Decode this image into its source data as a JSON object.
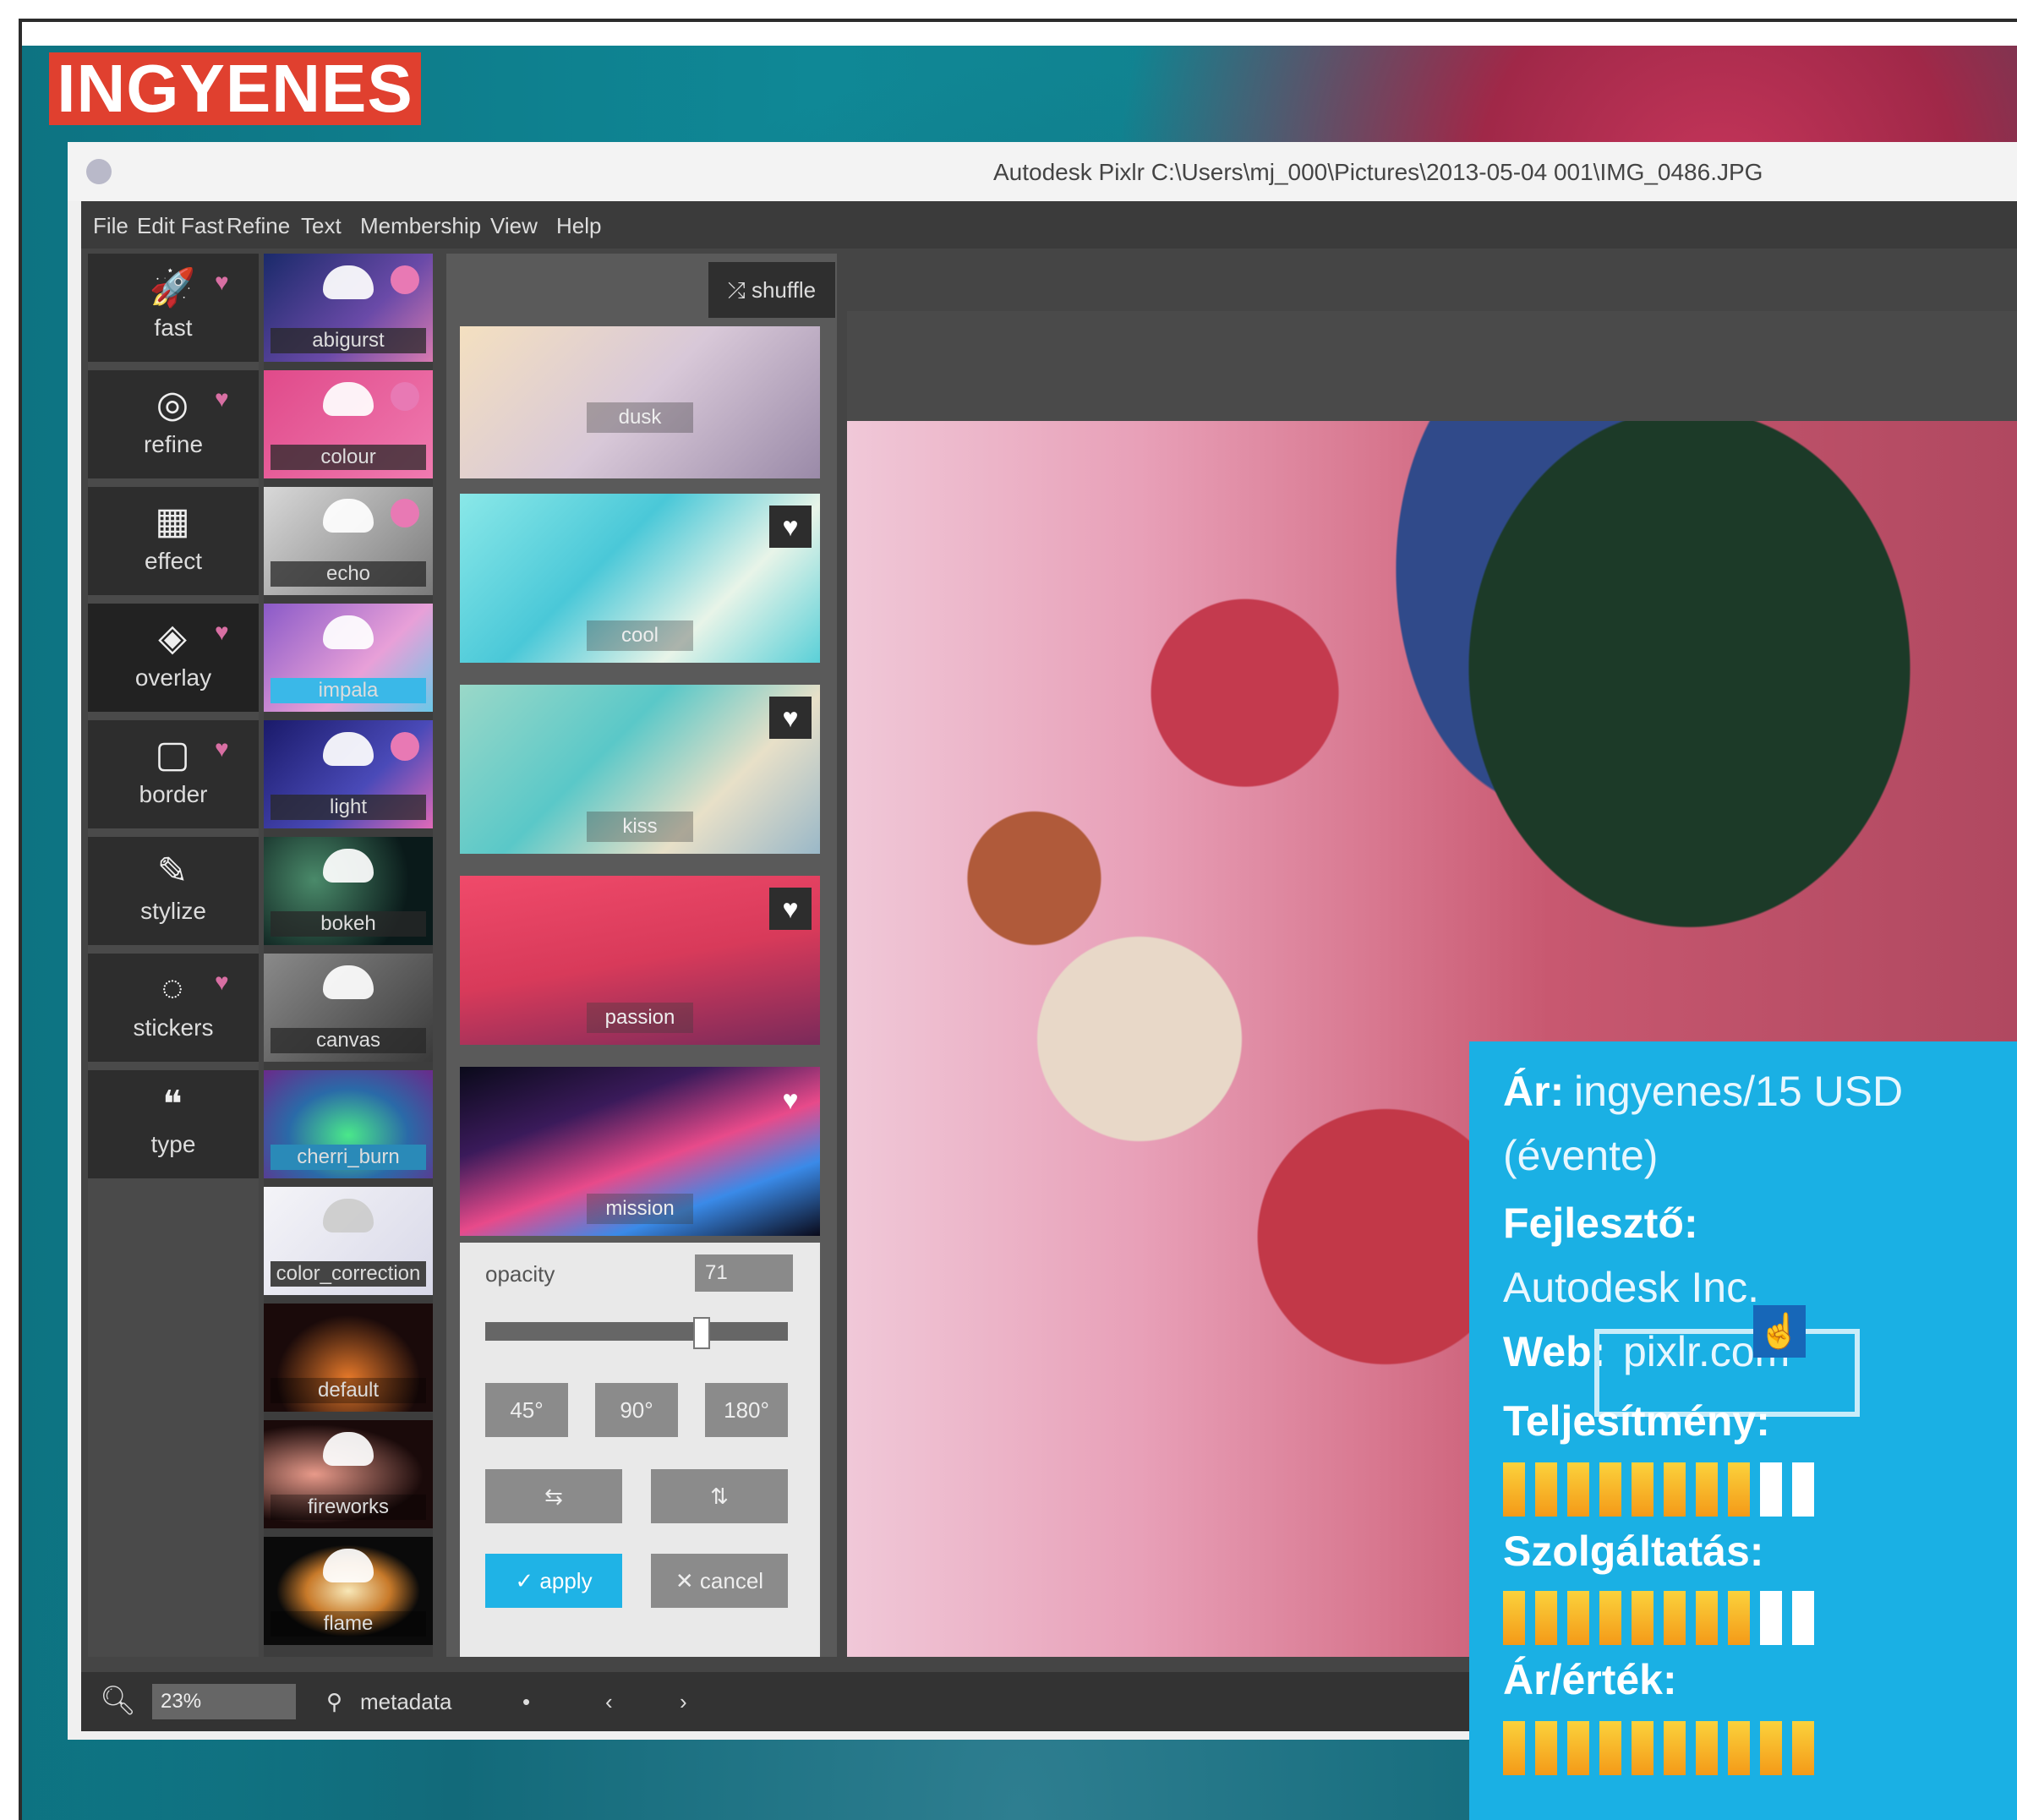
{
  "badge": "INGYENES",
  "window": {
    "title": "Autodesk Pixlr   C:\\Users\\mj_000\\Pictures\\2013-05-04 001\\IMG_0486.JPG"
  },
  "menu": [
    "File",
    "Edit",
    "Fast",
    "Refine",
    "Text",
    "Membership",
    "View",
    "Help"
  ],
  "categories": [
    {
      "label": "fast",
      "icon": "rocket-icon",
      "glyph": "🚀"
    },
    {
      "label": "refine",
      "icon": "aperture-icon",
      "glyph": "◎"
    },
    {
      "label": "effect",
      "icon": "film-icon",
      "glyph": "▦"
    },
    {
      "label": "overlay",
      "icon": "layers-icon",
      "glyph": "◈"
    },
    {
      "label": "border",
      "icon": "frame-icon",
      "glyph": "▢"
    },
    {
      "label": "stylize",
      "icon": "brush-icon",
      "glyph": "✎"
    },
    {
      "label": "stickers",
      "icon": "sticker-icon",
      "glyph": "◌"
    },
    {
      "label": "type",
      "icon": "quote-icon",
      "glyph": "❝"
    }
  ],
  "thumbs": [
    "abigurst",
    "colour",
    "echo",
    "impala",
    "light",
    "bokeh",
    "canvas",
    "cherri_burn",
    "color_correction",
    "default",
    "fireworks",
    "flame"
  ],
  "shuffle_label": "shuffle",
  "overlays": [
    "dusk",
    "cool",
    "kiss",
    "passion",
    "mission"
  ],
  "controls": {
    "opacity_label": "opacity",
    "opacity_value": "71",
    "opacity_fraction": 0.71,
    "rotate_45": "45°",
    "rotate_90": "90°",
    "rotate_180": "180°",
    "flip_h": "⇆",
    "flip_v": "⇅",
    "apply": "✓ apply",
    "cancel": "✕ cancel"
  },
  "status": {
    "zoom": "23%",
    "metadata": "metadata",
    "prev": "‹",
    "next": "›"
  },
  "info": {
    "price_label": "Ár:",
    "price_value": "ingyenes/15 USD",
    "price_note": "(évente)",
    "dev_label": "Fejlesztő:",
    "dev_value": "Autodesk Inc.",
    "web_label": "Web:",
    "web_value": "pixlr.com",
    "perf_label": "Teljesítmény:",
    "perf_filled": 8,
    "service_label": "Szolgáltatás:",
    "service_filled": 8,
    "value_label": "Ár/érték:",
    "value_filled": 10,
    "bars_total": 10
  }
}
